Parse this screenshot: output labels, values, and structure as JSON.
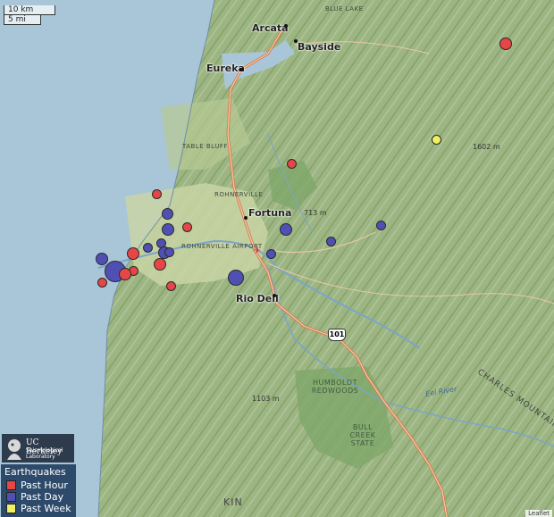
{
  "scale": {
    "km": "10 km",
    "mi": "5 mi"
  },
  "places": {
    "arcata": "Arcata",
    "bayside": "Bayside",
    "eureka": "Eureka",
    "fortuna": "Fortuna",
    "rio_dell": "Rio Dell",
    "blue_lake": "BLUE LAKE",
    "table_bluff": "TABLE BLUFF",
    "rohnerville": "ROHNERVILLE",
    "airport": "ROHNERVILLE AIRPORT",
    "humboldt_redwoods": "HUMBOLDT REDWOODS",
    "bull_creek_state": "BULL CREEK STATE",
    "charles_mountain": "CHARLES MOUNTAIN",
    "eel_river": "Eel River",
    "peak_1602": "1602 m",
    "peak_713": "713 m",
    "peak_1103": "1103 m",
    "highway_101": "101",
    "kin": "KIN"
  },
  "logo": {
    "line1": "UC Berkeley",
    "line2": "Seismological",
    "line3": "Laboratory"
  },
  "legend": {
    "title": "Earthquakes",
    "items": [
      {
        "label": "Past Hour",
        "color": "#e64646"
      },
      {
        "label": "Past Day",
        "color": "#5050b4"
      },
      {
        "label": "Past Week",
        "color": "#f0f064"
      }
    ]
  },
  "attribution": "Leaflet"
}
